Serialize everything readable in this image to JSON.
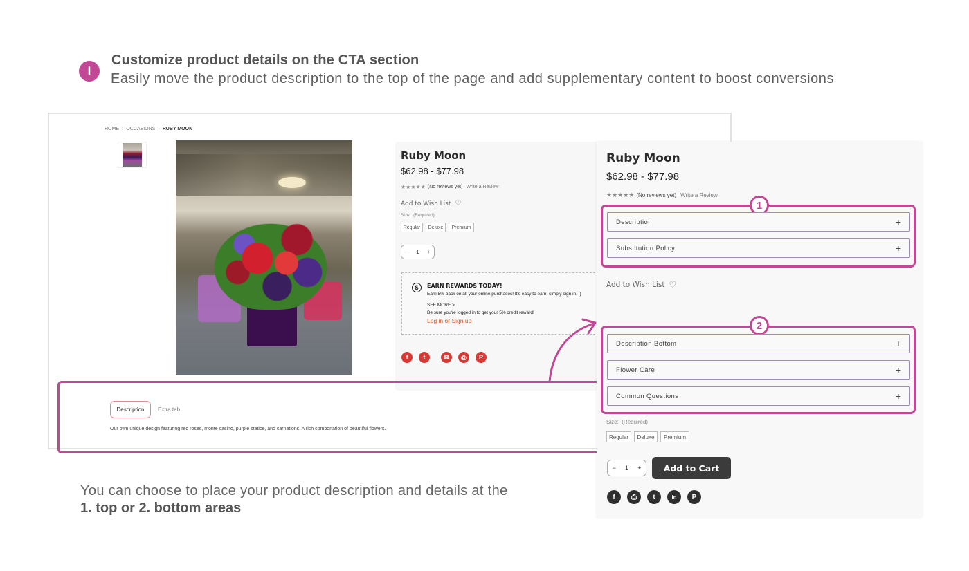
{
  "header": {
    "step_badge": "I",
    "title": "Customize product details on the CTA section",
    "subtitle": "Easily move the product description to the top of the page and add supplementary content to boost conversions"
  },
  "colors": {
    "accent": "#c04894",
    "share_red": "#d63a36",
    "share_dark": "#2f2f2f",
    "link_orange": "#e0521b",
    "button_dark": "#3b3b3b"
  },
  "left_page": {
    "breadcrumb": [
      "HOME",
      "OCCASIONS",
      "RUBY MOON"
    ],
    "product": {
      "title": "Ruby Moon",
      "price": "$62.98 - $77.98",
      "stars": "★★★★★",
      "reviews": "(No reviews yet)",
      "write_review": "Write a Review",
      "wish_list": "Add to Wish List",
      "size_label": "Size:",
      "size_required": "(Required)",
      "sizes": [
        "Regular",
        "Deluxe",
        "Premium"
      ],
      "qty": "1",
      "qty_minus": "−",
      "qty_plus": "+"
    },
    "rewards": {
      "icon": "$",
      "title": "EARN REWARDS TODAY!",
      "line1": "Earn 5% back on all your online purchases! It's easy to earn, simply sign in. :)",
      "see_more": "SEE MORE >",
      "line2": "Be sure you're logged in to get your 5% credit reward!",
      "link": "Log in or Sign up"
    },
    "share_icons": [
      {
        "name": "facebook-icon",
        "glyph": "f"
      },
      {
        "name": "twitter-icon",
        "glyph": "t"
      },
      {
        "name": "email-icon",
        "glyph": "✉"
      },
      {
        "name": "print-icon",
        "glyph": "⎙"
      },
      {
        "name": "pinterest-icon",
        "glyph": "P"
      }
    ],
    "tabs": {
      "active": "Description",
      "other": "Extra tab"
    },
    "description": "Our own unique design featuring red roses, monte casino, purple statice, and carnations. A rich combonation of beautiful flowers."
  },
  "right_page": {
    "title": "Ruby Moon",
    "price": "$62.98 - $77.98",
    "stars": "★★★★★",
    "reviews": "(No reviews yet)",
    "write_review": "Write a Review",
    "top_badge": "1",
    "top_accordion": [
      "Description",
      "Substitution Policy"
    ],
    "wish_list": "Add to Wish List",
    "bottom_badge": "2",
    "bottom_accordion": [
      "Description Bottom",
      "Flower Care",
      "Common Questions"
    ],
    "accordion_toggle": "+",
    "size_label": "Size:",
    "size_required": "(Required)",
    "sizes": [
      "Regular",
      "Deluxe",
      "Premium"
    ],
    "qty": "1",
    "qty_minus": "−",
    "qty_plus": "+",
    "add_to_cart": "Add to Cart",
    "share_icons": [
      {
        "name": "facebook-icon",
        "glyph": "f"
      },
      {
        "name": "print-icon",
        "glyph": "⎙"
      },
      {
        "name": "twitter-icon",
        "glyph": "t"
      },
      {
        "name": "linkedin-icon",
        "glyph": "in"
      },
      {
        "name": "pinterest-icon",
        "glyph": "P"
      }
    ]
  },
  "footer": {
    "line1": "You can choose to place your product description and details at the",
    "line2": "1. top or 2. bottom areas"
  }
}
